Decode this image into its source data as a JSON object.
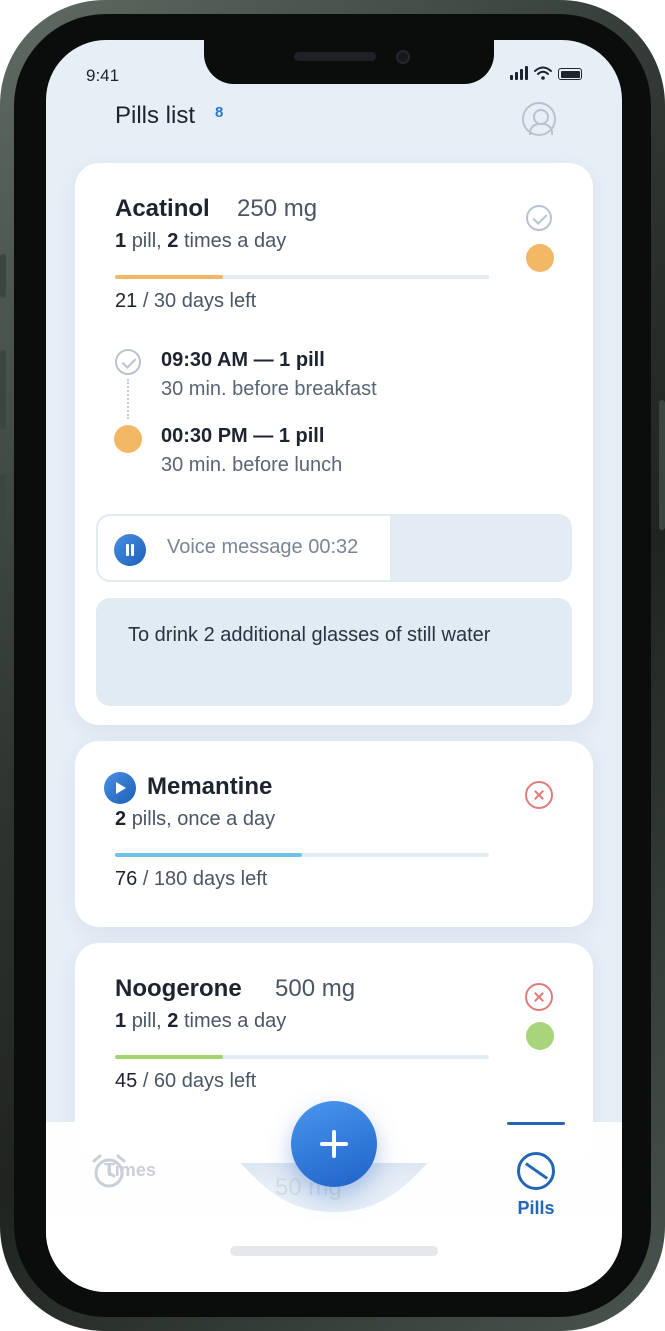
{
  "status_bar": {
    "time": "9:41"
  },
  "header": {
    "title": "Pills list",
    "count": "8"
  },
  "cards": [
    {
      "name": "Acatinol",
      "dose": "250 mg",
      "frequency_count": "1",
      "frequency_unit": "pill,",
      "frequency_times": "2",
      "frequency_rest": "times a day",
      "progress_fraction": 0.29,
      "progress_color": "#f2b866",
      "days_done": "21",
      "days_rest": "/ 30 days left",
      "status_color": "#f2b866",
      "schedule": [
        {
          "time": "09:30 AM — 1 pill",
          "note": "30 min. before breakfast",
          "state": "done"
        },
        {
          "time": "00:30 PM — 1 pill",
          "note": "30 min. before lunch",
          "state": "pending"
        }
      ],
      "voice_label": "Voice message 00:32",
      "note": "To drink 2 additional glasses of still water"
    },
    {
      "name": "Memantine",
      "frequency_count": "2",
      "frequency_rest": "pills, once a day",
      "progress_fraction": 0.5,
      "progress_color": "#6ec3ea",
      "days_done": "76",
      "days_rest": "/ 180 days left"
    },
    {
      "name": "Noogerone",
      "dose": "500 mg",
      "frequency_count": "1",
      "frequency_unit": "pill,",
      "frequency_times": "2",
      "frequency_rest": "times a day",
      "progress_fraction": 0.29,
      "progress_color": "#a4d46f",
      "days_done": "45",
      "days_rest": "/ 60 days left",
      "status_color": "#a8d47a"
    }
  ],
  "tabbar": {
    "times_label": "Times",
    "pills_label": "Pills",
    "ghost_text": "50 mg",
    "active_color": "#2366b8"
  },
  "colors": {
    "accent": "#2366b8",
    "background": "#e6eef6"
  }
}
